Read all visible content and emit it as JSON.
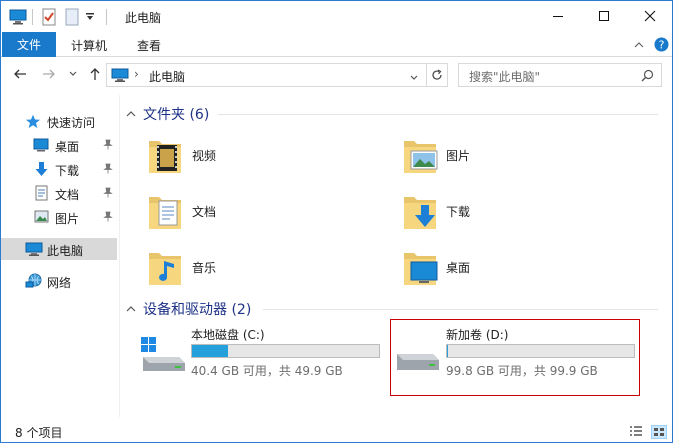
{
  "window": {
    "title": "此电脑"
  },
  "ribbon": {
    "file_tab": "文件",
    "tabs": [
      "计算机",
      "查看"
    ]
  },
  "address": {
    "location": "此电脑",
    "separator": "›"
  },
  "search": {
    "placeholder": "搜索\"此电脑\""
  },
  "sidebar": {
    "quick_access": "快速访问",
    "items": [
      {
        "label": "桌面",
        "icon": "desktop-icon",
        "pinned": true
      },
      {
        "label": "下载",
        "icon": "download-icon",
        "pinned": true
      },
      {
        "label": "文档",
        "icon": "document-icon",
        "pinned": true
      },
      {
        "label": "图片",
        "icon": "pictures-icon",
        "pinned": true
      }
    ],
    "this_pc": "此电脑",
    "network": "网络"
  },
  "folders_group": {
    "title": "文件夹 (6)"
  },
  "folders": [
    {
      "label": "视频",
      "icon": "videos-folder-icon"
    },
    {
      "label": "图片",
      "icon": "pictures-folder-icon"
    },
    {
      "label": "文档",
      "icon": "documents-folder-icon"
    },
    {
      "label": "下载",
      "icon": "downloads-folder-icon"
    },
    {
      "label": "音乐",
      "icon": "music-folder-icon"
    },
    {
      "label": "桌面",
      "icon": "desktop-folder-icon"
    }
  ],
  "drives_group": {
    "title": "设备和驱动器 (2)"
  },
  "drives": [
    {
      "name": "本地磁盘 (C:)",
      "free_text": "40.4 GB 可用，共 49.9 GB",
      "used_fraction": 0.19
    },
    {
      "name": "新加卷 (D:)",
      "free_text": "99.8 GB 可用，共 99.9 GB",
      "used_fraction": 0.001
    }
  ],
  "status": {
    "count": "8 个项目"
  },
  "colors": {
    "accent": "#1979ca",
    "bar_fill": "#26a0da",
    "selection_border": "#cc0000",
    "group_heading": "#1e3287"
  }
}
